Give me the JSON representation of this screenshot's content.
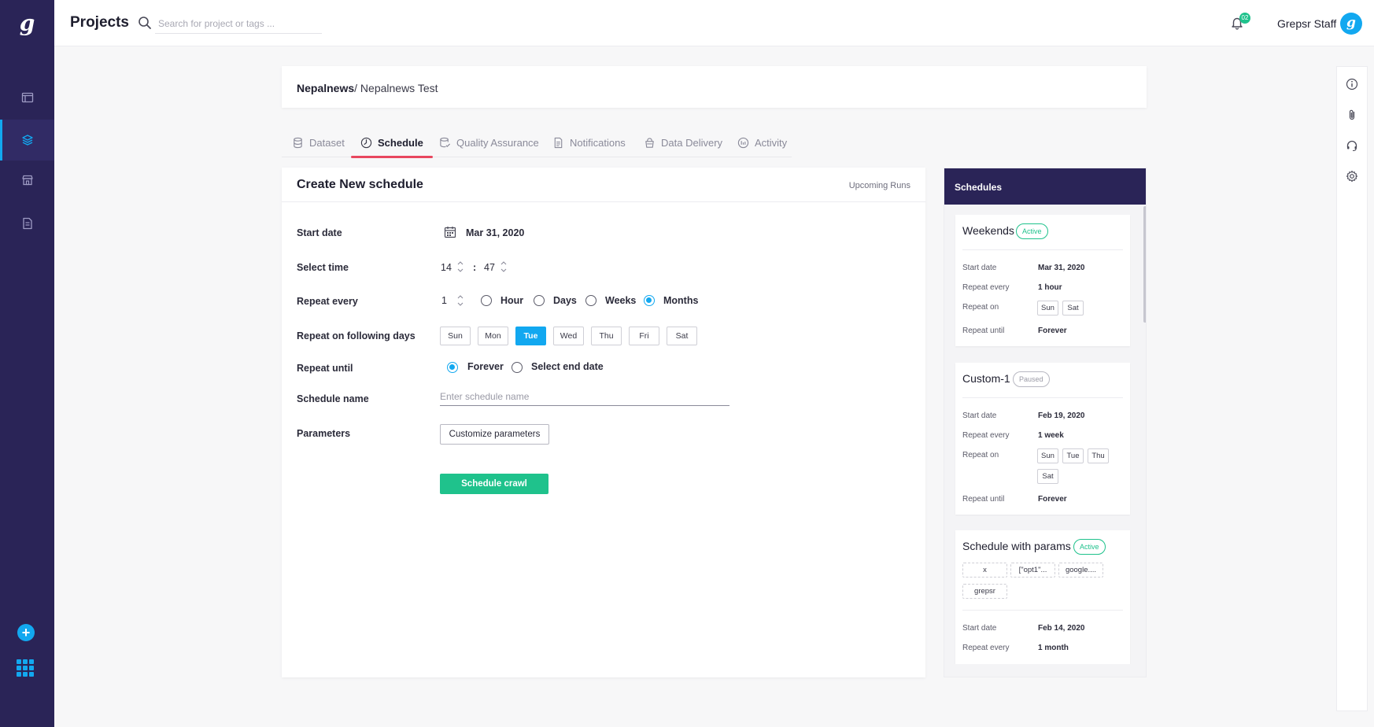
{
  "app": {
    "logo": "g"
  },
  "header": {
    "title": "Projects",
    "search_placeholder": "Search for project or tags ...",
    "notification_count": "02",
    "user_name": "Grepsr Staff",
    "avatar_letter": "g"
  },
  "breadcrumb": {
    "parent": "Nepalnews",
    "separator": "/",
    "current": " Nepalnews Test"
  },
  "tabs": [
    {
      "label": "Dataset",
      "icon": "database-icon"
    },
    {
      "label": "Schedule",
      "icon": "clock-icon"
    },
    {
      "label": "Quality Assurance",
      "icon": "qa-icon"
    },
    {
      "label": "Notifications",
      "icon": "document-icon"
    },
    {
      "label": "Data Delivery",
      "icon": "delivery-icon"
    },
    {
      "label": "Activity",
      "icon": "activity-icon"
    }
  ],
  "form": {
    "title": "Create New schedule",
    "upcoming_link": "Upcoming Runs",
    "start_date_label": "Start date",
    "start_date_value": "Mar 31, 2020",
    "select_time_label": "Select time",
    "time_hour": "14",
    "time_sep": ":",
    "time_minute": "47",
    "repeat_every_label": "Repeat every",
    "repeat_count": "1",
    "repeat_units": [
      "Hour",
      "Days",
      "Weeks",
      "Months"
    ],
    "repeat_unit_selected": "Months",
    "repeat_days_label": "Repeat on following days",
    "days": [
      "Sun",
      "Mon",
      "Tue",
      "Wed",
      "Thu",
      "Fri",
      "Sat"
    ],
    "day_selected": "Tue",
    "repeat_until_label": "Repeat until",
    "repeat_until_options": [
      "Forever",
      "Select end date"
    ],
    "repeat_until_selected": "Forever",
    "schedule_name_label": "Schedule name",
    "schedule_name_placeholder": "Enter schedule name",
    "parameters_label": "Parameters",
    "customize_button": "Customize parameters",
    "submit_button": "Schedule crawl"
  },
  "schedules": {
    "title": "Schedules",
    "labels": {
      "start": "Start date",
      "every": "Repeat every",
      "on": "Repeat on",
      "until": "Repeat until"
    },
    "items": [
      {
        "name": "Weekends",
        "status": "Active",
        "start": "Mar 31, 2020",
        "every": "1 hour",
        "days": [
          "Sun",
          "Sat"
        ],
        "until": "Forever"
      },
      {
        "name": "Custom-1",
        "status": "Paused",
        "start": "Feb 19, 2020",
        "every": "1 week",
        "days": [
          "Sun",
          "Tue",
          "Thu",
          "Sat"
        ],
        "until": "Forever"
      },
      {
        "name": "Schedule with params",
        "status": "Active",
        "params": [
          "x",
          "[\"opt1\"...",
          "google....",
          "grepsr"
        ],
        "start": "Feb 14, 2020",
        "every": "1 month"
      }
    ]
  },
  "colors": {
    "sidebar": "#2a2457",
    "accent": "#12a8f0",
    "success": "#1fc28c",
    "tab_underline": "#e8475f"
  }
}
